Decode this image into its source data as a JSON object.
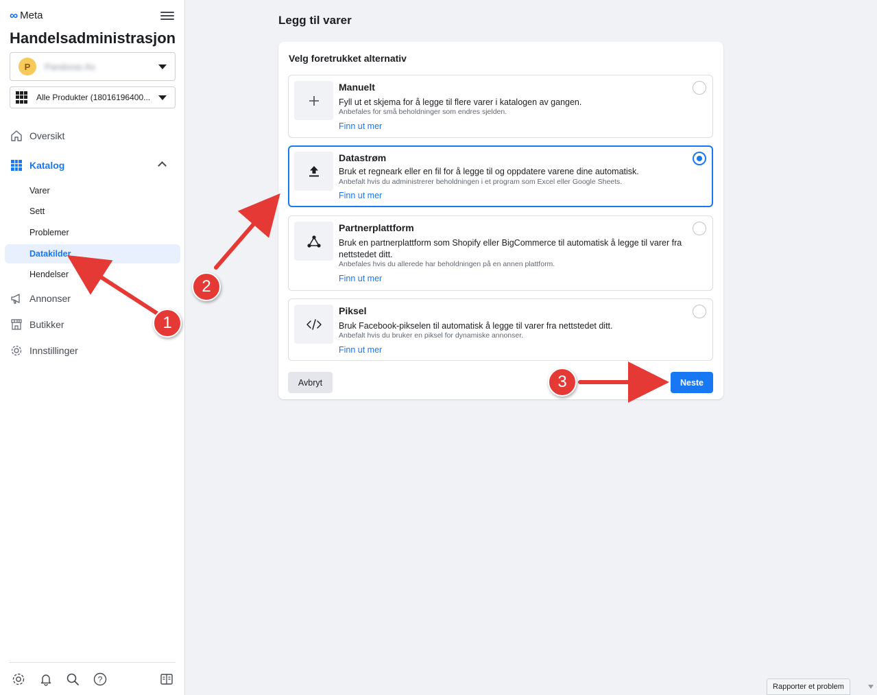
{
  "sidebar": {
    "brand": "Meta",
    "app_title": "Handelsadministrasjon",
    "account": {
      "initial": "P",
      "name": "Pandoras As"
    },
    "catalog_selector": "Alle Produkter (18016196400...",
    "nav": {
      "overview": "Oversikt",
      "catalog": "Katalog",
      "catalog_items": [
        "Varer",
        "Sett",
        "Problemer",
        "Datakilder",
        "Hendelser"
      ],
      "ads": "Annonser",
      "shops": "Butikker",
      "settings": "Innstillinger"
    }
  },
  "main": {
    "page_title": "Legg til varer",
    "card_heading": "Velg foretrukket alternativ",
    "options": [
      {
        "title": "Manuelt",
        "description": "Fyll ut et skjema for å legge til flere varer i katalogen av gangen.",
        "note": "Anbefales for små beholdninger som endres sjelden.",
        "link": "Finn ut mer",
        "icon": "plus-icon",
        "selected": false
      },
      {
        "title": "Datastrøm",
        "description": "Bruk et regneark eller en fil for å legge til og oppdatere varene dine automatisk.",
        "note": "Anbefalt hvis du administrerer beholdningen i et program som Excel eller Google Sheets.",
        "link": "Finn ut mer",
        "icon": "upload-icon",
        "selected": true
      },
      {
        "title": "Partnerplattform",
        "description": "Bruk en partnerplattform som Shopify eller BigCommerce til automatisk å legge til varer fra nettstedet ditt.",
        "note": "Anbefales hvis du allerede har beholdningen på en annen plattform.",
        "link": "Finn ut mer",
        "icon": "network-icon",
        "selected": false
      },
      {
        "title": "Piksel",
        "description": "Bruk Facebook-pikselen til automatisk å legge til varer fra nettstedet ditt.",
        "note": "Anbefalt hvis du bruker en piksel for dynamiske annonser.",
        "link": "Finn ut mer",
        "icon": "code-icon",
        "selected": false
      }
    ],
    "cancel_label": "Avbryt",
    "next_label": "Neste"
  },
  "footer": {
    "report_label": "Rapporter et problem"
  },
  "annotations": {
    "badges": [
      "1",
      "2",
      "3"
    ],
    "color": "#e53935"
  },
  "colors": {
    "accent": "#1877f2",
    "page_bg": "#f0f2f5"
  }
}
